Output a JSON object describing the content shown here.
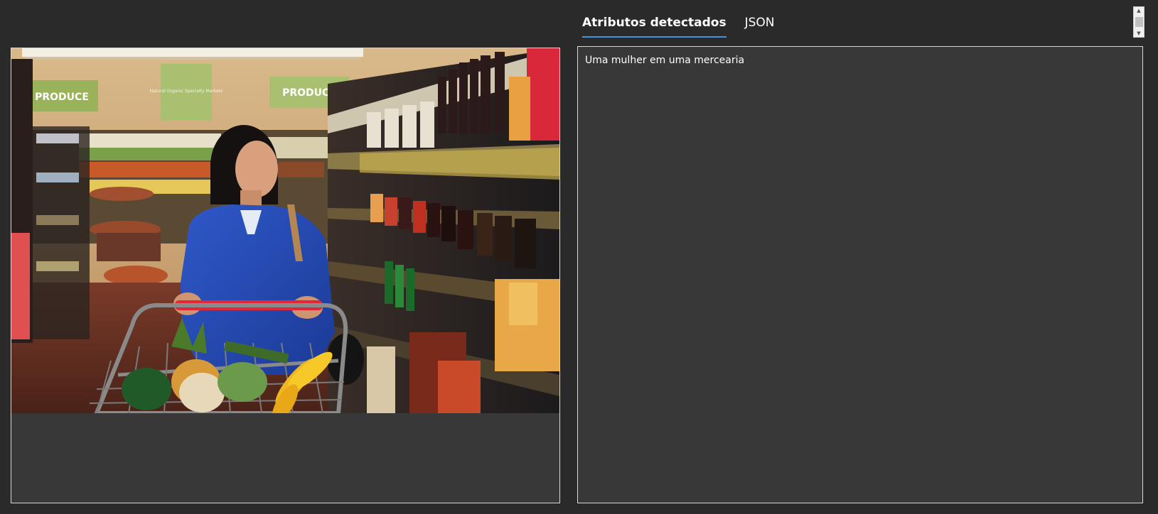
{
  "tabs": [
    {
      "label": "Atributos detectados",
      "active": true
    },
    {
      "label": "JSON",
      "active": false
    }
  ],
  "result": {
    "caption": "Uma mulher em uma mercearia"
  },
  "photo": {
    "sign_left": "PRODUCE",
    "sign_right": "PRODUCE",
    "sign_center": "Natural Organic Specialty Markets"
  },
  "colors": {
    "background": "#2a2a2a",
    "panel": "#383838",
    "panel_border": "#d8d8d8",
    "tab_underline": "#4a90e2"
  },
  "icons": {
    "scroll_up": "triangle-up-icon",
    "scroll_down": "triangle-down-icon"
  }
}
